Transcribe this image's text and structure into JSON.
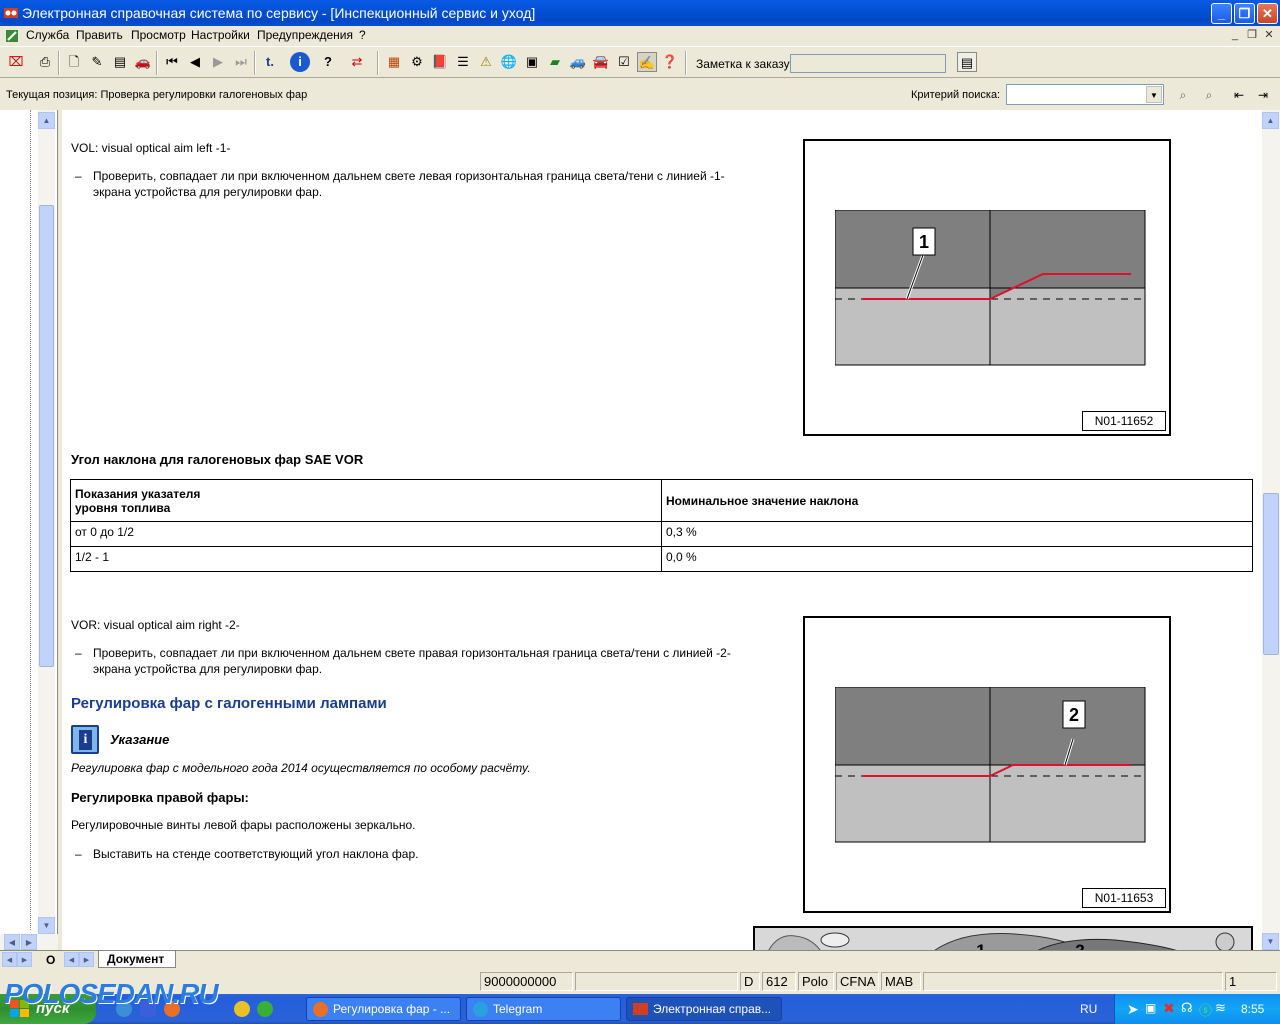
{
  "window": {
    "title": "Электронная справочная система по сервису - [Инспекционный сервис и уход]"
  },
  "menu": [
    "Служба",
    "Править",
    "Просмотр",
    "Настройки",
    "Предупреждения",
    "?"
  ],
  "toolbar": {
    "order_note_label": "Заметка к заказу:",
    "order_note_value": ""
  },
  "position_bar": {
    "current_position": "Текущая позиция: Проверка регулировки галогеновых фар",
    "search_label": "Критерий поиска:",
    "search_value": ""
  },
  "document": {
    "vol_title": "VOL: visual optical aim left -1-",
    "vol_step": "Проверить, совпадает ли при включенном дальнем свете левая горизонтальная граница света/тени с линией -1-",
    "vol_step_2": "экрана устройства для регулировки фар.",
    "fig1_code": "N01-11652",
    "fig1_callout": "1",
    "table_title": "Угол наклона для галогеновых фар SAE VOR",
    "table": {
      "headers": [
        "Показания указателя\nуровня топлива",
        "Номинальное значение наклона"
      ],
      "header_col1_line1": "Показания указателя",
      "header_col1_line2": "уровня топлива",
      "rows": [
        [
          "от 0 до 1/2",
          "0,3 %"
        ],
        [
          "1/2 - 1",
          "0,0 %"
        ]
      ]
    },
    "vor_title": "VOR: visual optical aim right -2-",
    "vor_step": "Проверить, совпадает ли при включенном дальнем свете правая горизонтальная граница света/тени с линией -2-",
    "vor_step_2": "экрана устройства для регулировки фар.",
    "fig2_code": "N01-11653",
    "fig2_callout": "2",
    "section_heading": "Регулировка фар с галогенными лампами",
    "note_label": "Указание",
    "note_text": "Регулировка фар с модельного года 2014 осуществляется по особому расчёту.",
    "right_headlight_heading": "Регулировка правой фары:",
    "right_headlight_text": "Регулировочные винты левой фары расположены зеркально.",
    "right_headlight_step": "Выставить на стенде соответствующий угол наклона фар.",
    "fig3_callouts": [
      "1",
      "2"
    ],
    "dash": "–"
  },
  "tabs": {
    "left_tab": "О",
    "doc_tab": "Документ"
  },
  "status": {
    "order_number": "9000000000",
    "field_d": "D",
    "field_num": "612",
    "field_model": "Polo",
    "field_engine": "CFNA",
    "field_gear": "MAB",
    "page": "1"
  },
  "taskbar": {
    "start": "пуск",
    "items": [
      "Регулировка фар - ...",
      "Telegram",
      "Электронная справ..."
    ],
    "lang": "RU",
    "clock": "8:55",
    "watermark": "POLOSEDAN.RU"
  },
  "colors": {
    "titlebar": "#0350d2",
    "heading": "#1a3d8f",
    "cutoff_line": "#e0102a",
    "screen_dark": "#7f7f7f",
    "screen_light": "#c0c0c0"
  }
}
